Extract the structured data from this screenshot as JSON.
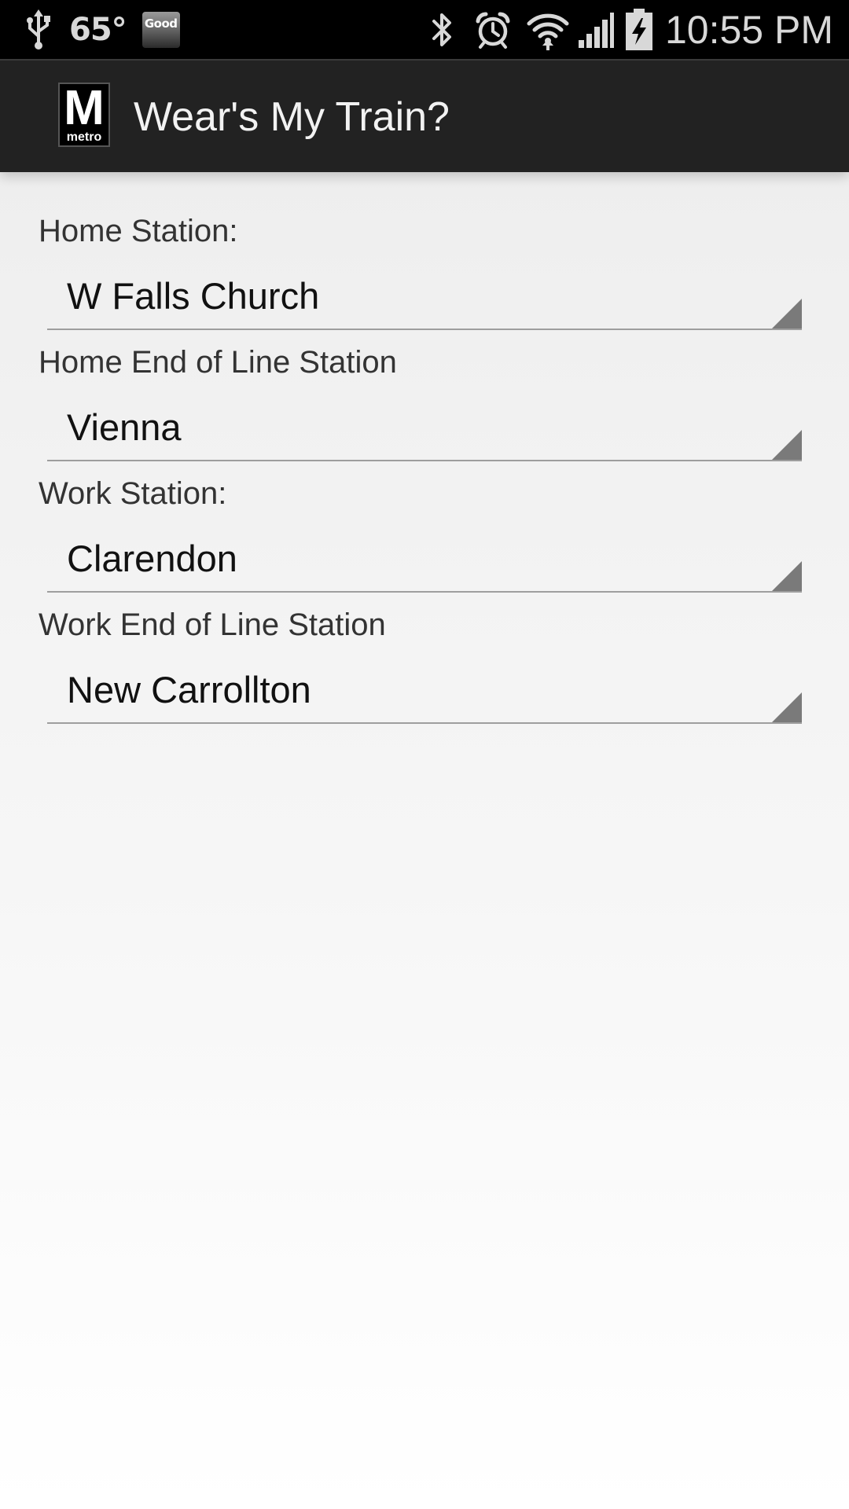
{
  "status_bar": {
    "icons": [
      "usb-icon",
      "bluetooth-icon",
      "alarm-icon",
      "wifi-icon",
      "signal-icon",
      "battery-charging-icon"
    ],
    "temperature": "65°",
    "weather_badge": "Good",
    "time": "10:55 PM"
  },
  "action_bar": {
    "logo_letter": "M",
    "logo_word": "metro",
    "title": "Wear's My Train?"
  },
  "form": {
    "fields": [
      {
        "label": "Home Station:",
        "value": "W Falls Church"
      },
      {
        "label": "Home End of Line Station",
        "value": "Vienna"
      },
      {
        "label": "Work Station:",
        "value": "Clarendon"
      },
      {
        "label": "Work End of Line Station",
        "value": "New Carrollton"
      }
    ]
  }
}
